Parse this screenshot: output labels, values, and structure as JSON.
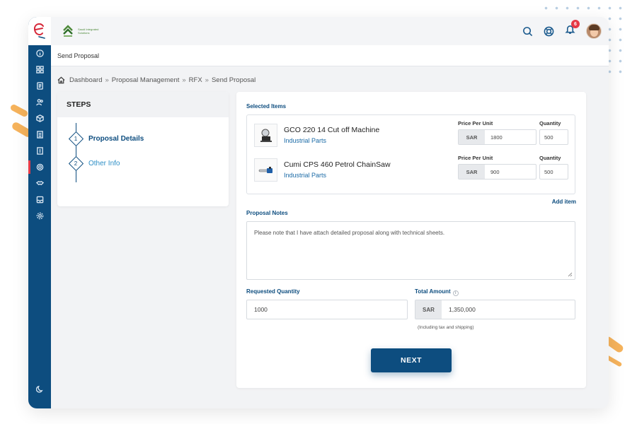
{
  "brand": {
    "logo_text": "Saudi Integrated Solutions"
  },
  "topbar": {
    "notification_count": "6"
  },
  "subbar": {
    "title": "Send Proposal"
  },
  "breadcrumb": [
    "Dashboard",
    "Proposal Management",
    "RFX",
    "Send Proposal"
  ],
  "breadcrumb_sep": "»",
  "steps": {
    "heading": "STEPS",
    "items": [
      {
        "num": "1",
        "label": "Proposal Details",
        "state": "active"
      },
      {
        "num": "2",
        "label": "Other Info",
        "state": "inactive"
      }
    ]
  },
  "selected_items": {
    "label": "Selected Items",
    "price_header": "Price Per Unit",
    "qty_header": "Quantity",
    "currency": "SAR",
    "items": [
      {
        "name": "GCO 220 14 Cut off Machine",
        "category": "Industrial Parts",
        "price": "1800",
        "quantity": "500",
        "thumb_icon": "cutoff-machine-icon"
      },
      {
        "name": "Cumi CPS 460 Petrol ChainSaw",
        "category": "Industrial Parts",
        "price": "900",
        "quantity": "500",
        "thumb_icon": "chainsaw-icon"
      }
    ],
    "add_item": "Add item"
  },
  "notes": {
    "label": "Proposal Notes",
    "value": "Please note that I have attach detailed proposal along with technical sheets."
  },
  "requested_quantity": {
    "label": "Requested Quantity",
    "value": "1000"
  },
  "total_amount": {
    "label": "Total Amount",
    "currency": "SAR",
    "value": "1,350,000",
    "hint": "(Including tax and shipping)"
  },
  "next_button": "NEXT",
  "colors": {
    "primary": "#0d4d7f",
    "accent": "#f6b35c",
    "badge": "#e63946",
    "link": "#1a6aa6"
  }
}
